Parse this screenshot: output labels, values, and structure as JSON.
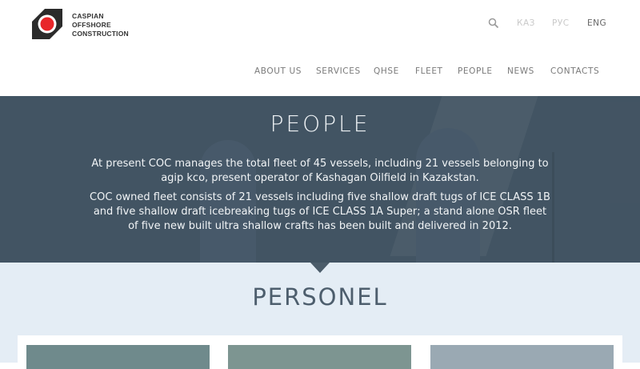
{
  "brand": {
    "logo_lines": [
      "CASPIAN",
      "OFFSHORE",
      "CONSTRUCTION"
    ],
    "colors": {
      "logo_dark": "#2b2b2b",
      "logo_red": "#e8262a"
    }
  },
  "header": {
    "search_icon": "search-icon",
    "languages": [
      {
        "label": "КАЗ",
        "active": false
      },
      {
        "label": "РУС",
        "active": false
      },
      {
        "label": "ENG",
        "active": true
      }
    ],
    "nav": [
      "ABOUT US",
      "SERVICES",
      "QHSE",
      "FLEET",
      "PEOPLE",
      "NEWS",
      "CONTACTS"
    ]
  },
  "hero": {
    "title": "PEOPLE",
    "paragraphs": [
      "At present COC manages the total fleet of 45 vessels, including 21 vessels belonging to agip kco, present operator of Kashagan Oilfield in Kazakstan.",
      "COC owned fleet consists of 21 vessels including five shallow draft tugs of ICE CLASS 1B and five shallow draft icebreaking tugs of ICE CLASS 1A Super; a stand alone OSR fleet of five new built ultra shallow crafts has been built and delivered in 2012."
    ],
    "colors": {
      "overlay": "#4b5c6a"
    }
  },
  "section": {
    "title": "PERSONEL",
    "colors": {
      "background": "#e4edf5",
      "title": "#4d5e6d"
    }
  }
}
